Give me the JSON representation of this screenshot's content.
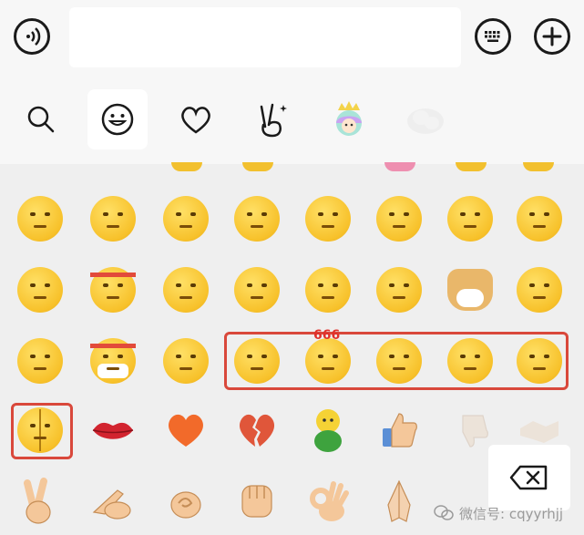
{
  "topbar": {
    "voice_icon": "voice-input-icon",
    "text_field_value": "",
    "keyboard_icon": "keyboard-icon",
    "plus_icon": "plus-icon"
  },
  "tabs": [
    {
      "icon": "search-icon",
      "active": false
    },
    {
      "icon": "smiley-icon",
      "active": true
    },
    {
      "icon": "heart-icon",
      "active": false
    },
    {
      "icon": "victory-hand-icon",
      "active": false
    },
    {
      "icon": "sticker-character-icon",
      "active": false
    },
    {
      "icon": "sticker-pack-icon",
      "active": false
    }
  ],
  "emoji_rows": [
    [
      "pensive",
      "unamused",
      "peek",
      "facepalm",
      "smirk",
      "side-eye",
      "shy-smile",
      "grin"
    ],
    [
      "watermelon-face",
      "fighting-headband",
      "sweat-face",
      "stunned",
      "snore",
      "chin-stroke",
      "doge",
      "wink-chin"
    ],
    [
      "kiss-wave",
      "mask-headband",
      "starry-eyes",
      "eye-roll",
      "six-six-six",
      "hide-face",
      "sad-finger",
      "teary"
    ],
    [
      "broken-face",
      "lips",
      "heart",
      "broken-heart",
      "green-chick",
      "thumbs-up",
      "thumbs-down",
      "handshake"
    ],
    [
      "victory-hand",
      "pointing-hand",
      "curl-hand",
      "fist",
      "ok-hand",
      "praying-hands"
    ]
  ],
  "labels": {
    "six_six_six": "666",
    "watermark": "微信号: cqyyrhjj"
  },
  "delete_icon": "backspace-icon",
  "highlight_color": "#d9483b"
}
